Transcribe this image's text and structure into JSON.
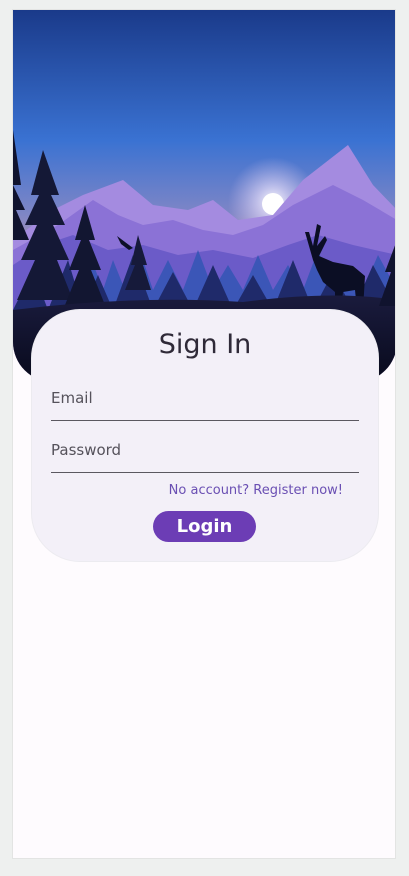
{
  "signin": {
    "title": "Sign In",
    "email_label": "Email",
    "password_label": "Password",
    "register_link": "No account? Register now!",
    "login_button": "Login"
  },
  "colors": {
    "accent": "#6c3db5",
    "link": "#6a4fb3",
    "card_bg": "#f3f0f8",
    "page_bg": "#fefbfe"
  }
}
